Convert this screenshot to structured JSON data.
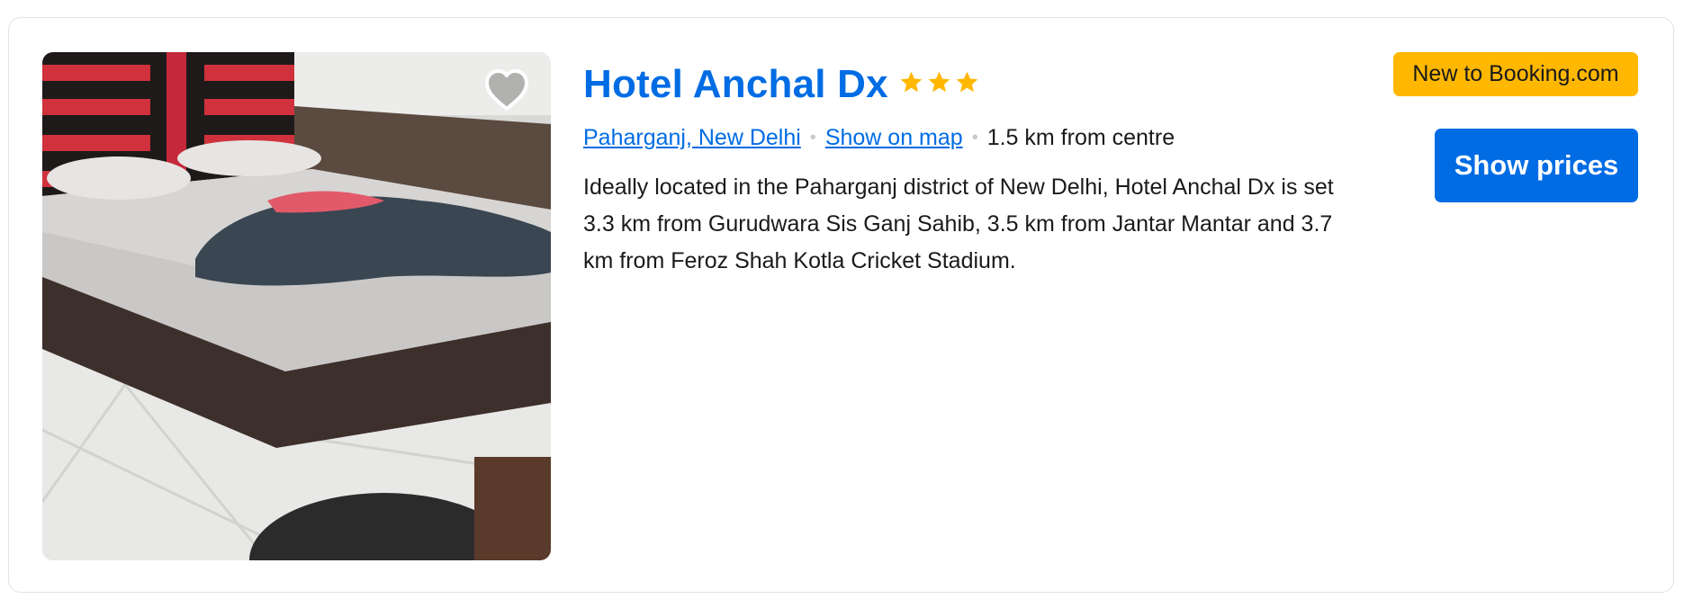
{
  "property": {
    "name": "Hotel Anchal Dx",
    "star_rating": 3,
    "location_link": "Paharganj, New Delhi",
    "map_link": "Show on map",
    "distance": "1.5 km from centre",
    "description": "Ideally located in the Paharganj district of New Delhi, Hotel Anchal Dx is set 3.3 km from Gurudwara Sis Ganj Sahib, 3.5 km from Jantar Mantar and 3.7 km from Feroz Shah Kotla Cricket Stadium.",
    "badge": "New to Booking.com",
    "cta_label": "Show prices",
    "image_icon": "hotel-room-bed-photo",
    "favorite_icon": "heart-outline-icon",
    "star_icon": "star-icon"
  },
  "colors": {
    "link": "#006ce4",
    "badge_bg": "#ffb700",
    "button_bg": "#006ce4",
    "star": "#ffb700",
    "text": "#1a1a1a"
  }
}
